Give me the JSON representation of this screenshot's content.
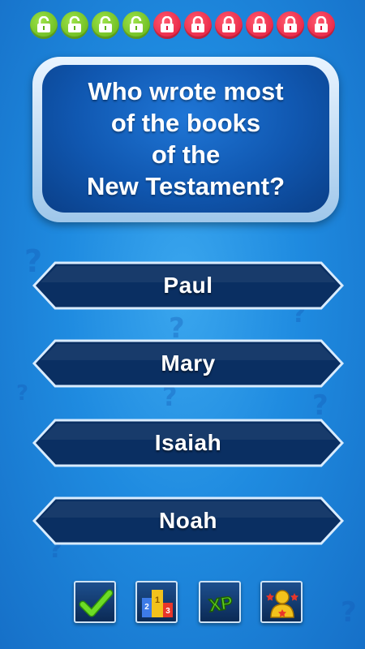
{
  "levels": [
    {
      "state": "unlocked",
      "icon": "unlocked-padlock-icon"
    },
    {
      "state": "unlocked",
      "icon": "unlocked-padlock-icon"
    },
    {
      "state": "unlocked",
      "icon": "unlocked-padlock-icon"
    },
    {
      "state": "unlocked",
      "icon": "unlocked-padlock-icon"
    },
    {
      "state": "locked",
      "icon": "locked-padlock-icon"
    },
    {
      "state": "locked",
      "icon": "locked-padlock-icon"
    },
    {
      "state": "locked",
      "icon": "locked-padlock-icon"
    },
    {
      "state": "locked",
      "icon": "locked-padlock-icon"
    },
    {
      "state": "locked",
      "icon": "locked-padlock-icon"
    },
    {
      "state": "locked",
      "icon": "locked-padlock-icon"
    }
  ],
  "question": {
    "lines": [
      "Who wrote most",
      "of the books",
      "of the",
      "New Testament?"
    ]
  },
  "answers": [
    {
      "label": "Paul"
    },
    {
      "label": "Mary"
    },
    {
      "label": "Isaiah"
    },
    {
      "label": "Noah"
    }
  ],
  "toolbar": {
    "buttons": [
      {
        "icon": "checkmark-icon"
      },
      {
        "icon": "podium-icon",
        "ranks": [
          "2",
          "1",
          "3"
        ]
      },
      {
        "icon": "xp-icon",
        "text": "XP"
      },
      {
        "icon": "achievement-person-icon"
      }
    ]
  },
  "colors": {
    "background": "#1f8be0",
    "unlocked": "#6cc51f",
    "locked": "#e8203f",
    "answer_fill": "#0a2f62",
    "answer_border": "#d9ecff",
    "checkmark": "#5fd11f"
  }
}
